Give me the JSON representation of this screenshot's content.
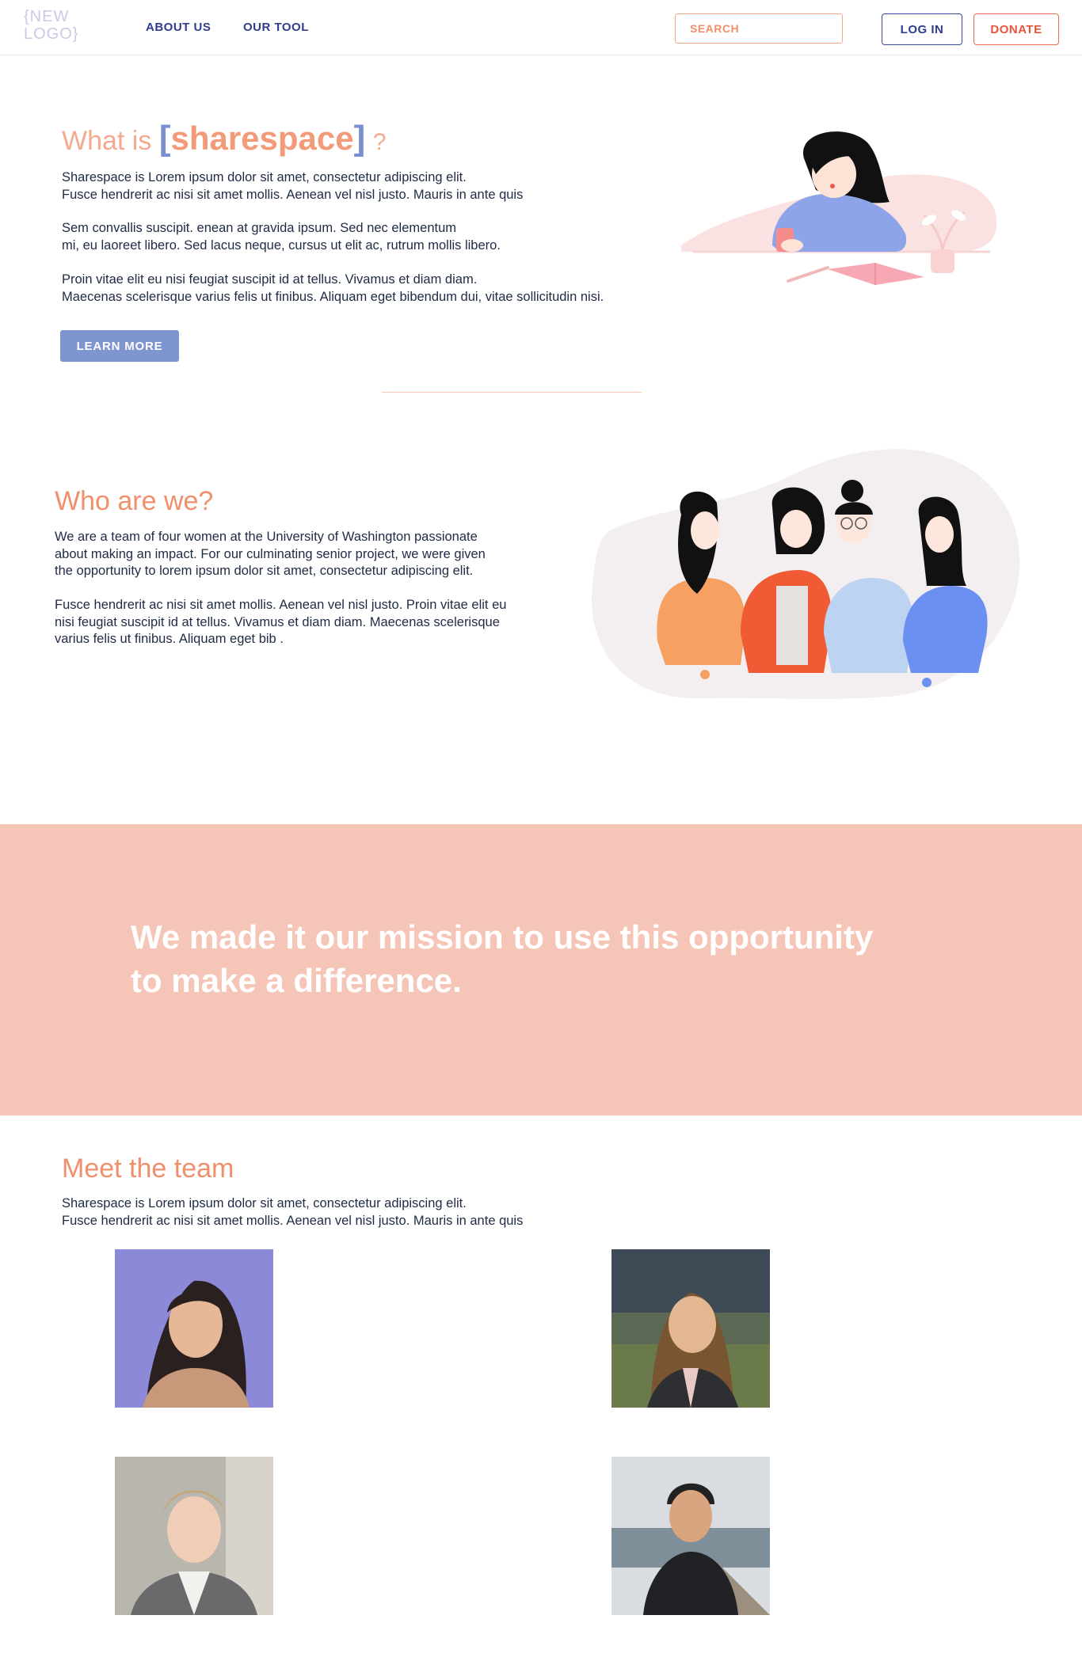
{
  "header": {
    "logo": "{NEW\nLOGO}",
    "nav": [
      {
        "label": "ABOUT US"
      },
      {
        "label": "OUR TOOL"
      }
    ],
    "search_placeholder": "SEARCH",
    "login_label": "LOG IN",
    "donate_label": "DONATE"
  },
  "intro": {
    "heading_prefix": "What is",
    "bracket_open": "[",
    "brand": "sharespace",
    "bracket_close": "]",
    "question": "?",
    "paragraphs": [
      "Sharespace is Lorem ipsum dolor sit amet, consectetur adipiscing elit.\nFusce hendrerit ac nisi sit amet mollis. Aenean vel nisl justo. Mauris in ante quis",
      "Sem convallis suscipit. enean at gravida ipsum. Sed nec elementum\nmi, eu laoreet libero. Sed lacus neque, cursus ut elit ac, rutrum mollis libero.",
      "Proin vitae elit eu nisi feugiat suscipit id at tellus. Vivamus et diam diam.\nMaecenas scelerisque varius felis ut finibus. Aliquam eget bibendum dui, vitae sollicitudin nisi."
    ],
    "learn_more_label": "LEARN MORE"
  },
  "who": {
    "heading": "Who are we?",
    "paragraphs": [
      "We are a team of four women at the University of Washington passionate\nabout making an impact.  For our culminating senior project, we were given\nthe opportunity to lorem ipsum dolor sit amet,  consectetur adipiscing elit.",
      "Fusce hendrerit ac nisi sit amet mollis. Aenean vel nisl justo. Proin vitae elit eu\nnisi feugiat suscipit id at tellus. Vivamus et diam diam.  Maecenas scelerisque\nvarius felis ut finibus. Aliquam eget bib ."
    ]
  },
  "mission": {
    "text": "We made it our mission to use this opportunity\nto make a difference."
  },
  "team": {
    "heading": "Meet the team",
    "intro": "Sharespace is Lorem ipsum dolor sit amet, consectetur adipiscing elit.\nFusce hendrerit ac nisi sit amet mollis. Aenean vel nisl justo. Mauris in ante quis"
  },
  "colors": {
    "accent_coral": "#f08f6b",
    "accent_blue": "#7f95cf",
    "navy": "#2f3d8f",
    "mission_bg": "#f5c6b7"
  }
}
